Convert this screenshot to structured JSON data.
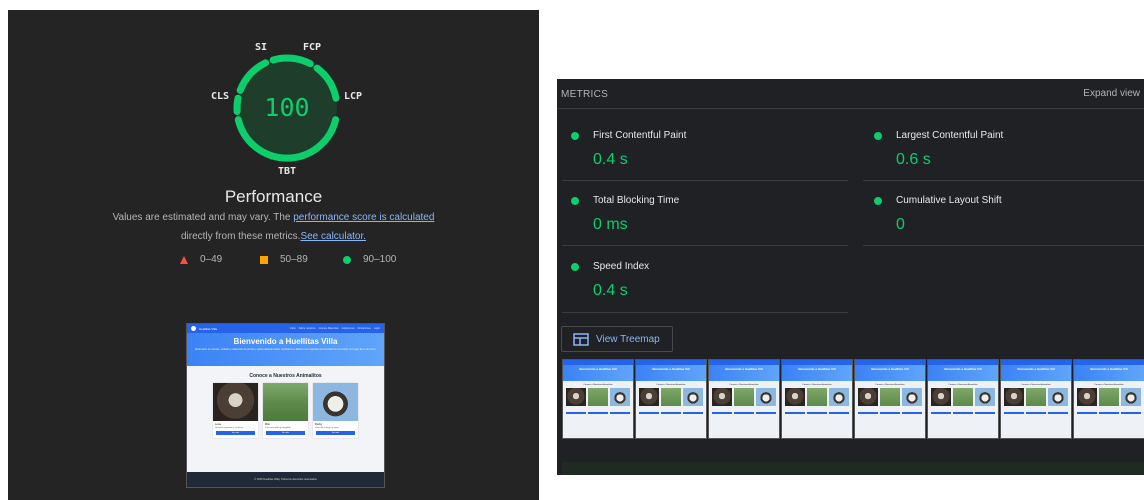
{
  "gauge": {
    "score": "100",
    "labels": {
      "si": "SI",
      "fcp": "FCP",
      "lcp": "LCP",
      "tbt": "TBT",
      "cls": "CLS"
    },
    "color": "#0cce6b"
  },
  "performance": {
    "title": "Performance",
    "desc_pre": "Values are estimated and may vary. The ",
    "desc_link1": "performance score is calculated",
    "desc_mid": "directly from these metrics.",
    "desc_link2": "See calculator."
  },
  "legend": [
    {
      "range": "0–49",
      "shape": "triangle",
      "color": "#ff4e42"
    },
    {
      "range": "50–89",
      "shape": "square",
      "color": "#ffa400"
    },
    {
      "range": "90–100",
      "shape": "circle",
      "color": "#0cce6b"
    }
  ],
  "screenshot": {
    "brand": "Huellitas Villa",
    "nav_links": [
      "Inicio",
      "Sobre nosotros",
      "Conoce Mascotas",
      "Adopciones",
      "Donaciones",
      "Login"
    ],
    "hero_title": "Bienvenido a Huellitas Villa",
    "hero_sub": "Dedicados al rescate, cuidado y adopción de perros y gatos abandonados. Ayúdanos a darles una segunda oportunidad de encontrar un hogar lleno de amor.",
    "section_title": "Conoce a Nuestros Animalitos",
    "pets": [
      {
        "name": "Luna",
        "desc": "Un felino juguetón y cariñoso.",
        "button": "Ver más"
      },
      {
        "name": "Milo",
        "desc": "Perro tranquilo y amigable.",
        "button": "Ver más"
      },
      {
        "name": "Rocky",
        "desc": "Lleno de energía y amor.",
        "button": "Ver más"
      }
    ],
    "footer": "© 2025 Huellitas Villa | Todos los derechos reservados"
  },
  "metrics": {
    "title": "METRICS",
    "expand": "Expand view",
    "items": [
      {
        "label": "First Contentful Paint",
        "value": "0.4 s"
      },
      {
        "label": "Largest Contentful Paint",
        "value": "0.6 s"
      },
      {
        "label": "Total Blocking Time",
        "value": "0 ms"
      },
      {
        "label": "Cumulative Layout Shift",
        "value": "0"
      },
      {
        "label": "Speed Index",
        "value": "0.4 s"
      }
    ],
    "treemap_button": "View Treemap"
  },
  "filmstrip": {
    "frame_title": "Bienvenido a Huellitas Vill",
    "frame_section": "Conoce a Nuestros Animalitos",
    "frame_count": 8
  }
}
